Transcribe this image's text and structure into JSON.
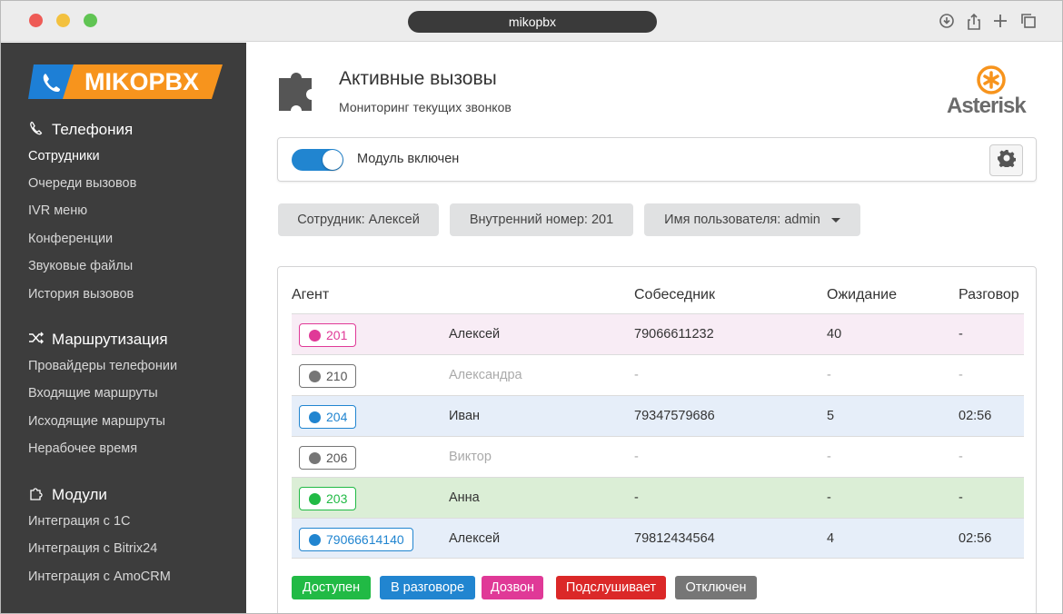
{
  "browser": {
    "url": "mikopbx"
  },
  "logo": {
    "text": "MIKOPBX"
  },
  "sidebar": {
    "sections": [
      {
        "title": "Телефония",
        "icon": "phone-icon",
        "items": [
          "Сотрудники",
          "Очереди вызовов",
          "IVR меню",
          "Конференции",
          "Звуковые файлы",
          "История вызовов"
        ]
      },
      {
        "title": "Маршрутизация",
        "icon": "shuffle-icon",
        "items": [
          "Провайдеры телефонии",
          "Входящие маршруты",
          "Исходящие маршруты",
          "Нерабочее время"
        ]
      },
      {
        "title": "Модули",
        "icon": "puzzle-icon",
        "items": [
          "Интеграция с 1С",
          "Интеграция с Bitrix24",
          "Интеграция с AmoCRM"
        ]
      }
    ],
    "active_item": "Сотрудники"
  },
  "header": {
    "title": "Активные вызовы",
    "subtitle": "Мониторинг текущих звонков",
    "brand": "Asterisk"
  },
  "module": {
    "label": "Модуль включен",
    "enabled": true
  },
  "filters": {
    "employee": "Сотрудник: Алексей",
    "extension": "Внутренний номер: 201",
    "username": "Имя пользователя: admin"
  },
  "table": {
    "columns": [
      "Агент",
      "Собеседник",
      "Ожидание",
      "Разговор"
    ],
    "rows": [
      {
        "agent": "201",
        "name": "Алексей",
        "peer": "79066611232",
        "wait": "40",
        "talk": "-",
        "state": "dialing"
      },
      {
        "agent": "210",
        "name": "Александра",
        "peer": "-",
        "wait": "-",
        "talk": "-",
        "state": "offline"
      },
      {
        "agent": "204",
        "name": "Иван",
        "peer": "79347579686",
        "wait": "5",
        "talk": "02:56",
        "state": "talking"
      },
      {
        "agent": "206",
        "name": "Виктор",
        "peer": "-",
        "wait": "-",
        "talk": "-",
        "state": "offline"
      },
      {
        "agent": "203",
        "name": "Анна",
        "peer": "-",
        "wait": "-",
        "talk": "-",
        "state": "available"
      },
      {
        "agent": "79066614140",
        "name": "Алексей",
        "peer": "79812434564",
        "wait": "4",
        "talk": "02:56",
        "state": "talking"
      }
    ]
  },
  "legend": [
    {
      "label": "Доступен",
      "color": "#21ba45"
    },
    {
      "label": "В разговоре",
      "color": "#2185d0"
    },
    {
      "label": "Дозвон",
      "color": "#e03997"
    },
    {
      "label": "Подслушивает",
      "color": "#db2828"
    },
    {
      "label": "Отключен",
      "color": "#767676"
    }
  ],
  "colors": {
    "sidebar": "#3d3d3d",
    "accent": "#2185d0",
    "logo_blue": "#1d7fd6",
    "logo_orange": "#f7941d",
    "asterisk_orange": "#f7941d"
  }
}
